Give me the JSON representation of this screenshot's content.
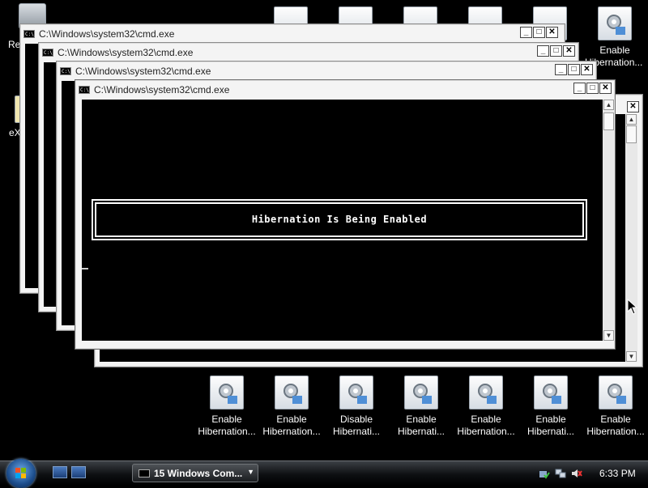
{
  "desktop": {
    "recycle_label_partial": "Re",
    "left_partial_label": "eX",
    "top_right_icon": {
      "label_line1": "Enable",
      "label_line2": "Hibernation..."
    },
    "bottom_icons": [
      {
        "line1": "Enable",
        "line2": "Hibernation..."
      },
      {
        "line1": "Enable",
        "line2": "Hibernation..."
      },
      {
        "line1": "Disable",
        "line2": "Hibernati..."
      },
      {
        "line1": "Enable",
        "line2": "Hibernati..."
      },
      {
        "line1": "Enable",
        "line2": "Hibernation..."
      },
      {
        "line1": "Enable",
        "line2": "Hibernati..."
      },
      {
        "line1": "Enable",
        "line2": "Hibernation..."
      }
    ]
  },
  "windows": [
    {
      "title": "C:\\Windows\\system32\\cmd.exe"
    },
    {
      "title": "C:\\Windows\\system32\\cmd.exe"
    },
    {
      "title": "C:\\Windows\\system32\\cmd.exe"
    },
    {
      "title": "C:\\Windows\\system32\\cmd.exe"
    }
  ],
  "console": {
    "message": "Hibernation Is Being Enabled"
  },
  "controls": {
    "minimize": "_",
    "maximize": "□",
    "close": "✕"
  },
  "taskbar": {
    "group_label": "15 Windows Com...",
    "clock": "6:33 PM"
  },
  "colors": {
    "console_bg": "#000000",
    "console_text": "#ffffff",
    "taskbar": "#0d0f12"
  }
}
